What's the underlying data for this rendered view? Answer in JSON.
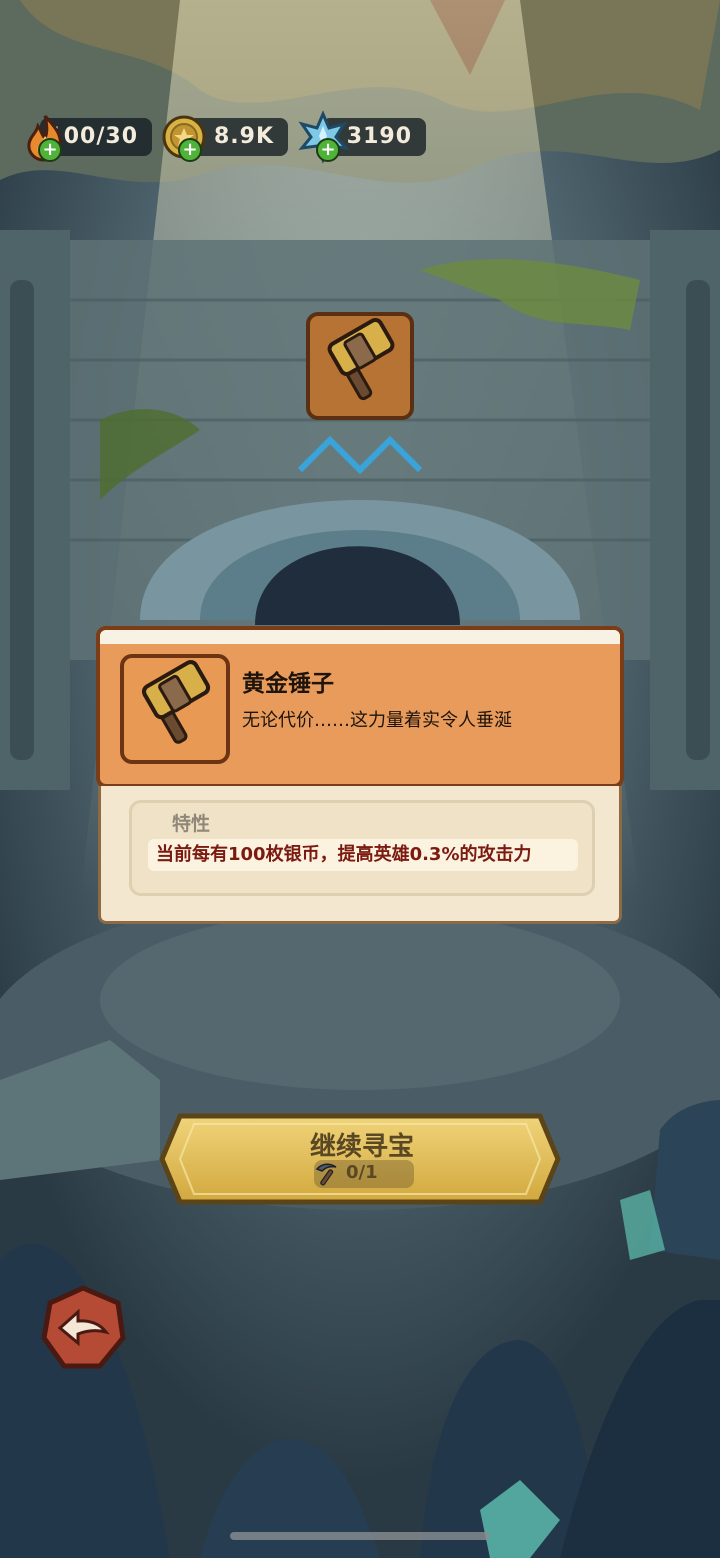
{
  "resources": {
    "energy": {
      "value": "100/30",
      "icon": "flame-icon"
    },
    "coins": {
      "value": "8.9K",
      "icon": "coin-icon"
    },
    "crystals": {
      "value": "3190",
      "icon": "crystal-icon"
    }
  },
  "item_popup": {
    "title": "黄金锤子",
    "description": "无论代价……这力量着实令人垂涎",
    "trait_label": "特性",
    "trait_text": "当前每有100枚银币，提高英雄0.3%的攻击力"
  },
  "continue_button": {
    "label": "继续寻宝",
    "count": "0/1",
    "icon": "pickaxe-icon"
  },
  "back_button": {
    "icon": "back-arrow-icon"
  },
  "colors": {
    "card_orange": "#e89b5a",
    "button_gold": "#e4c15a",
    "trait_text": "#7a1a10"
  }
}
